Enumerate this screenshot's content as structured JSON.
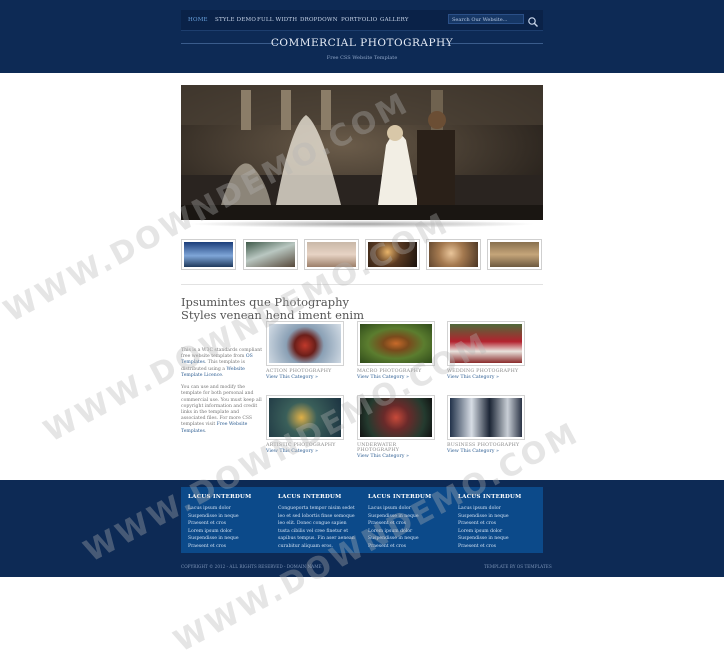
{
  "nav": {
    "items": [
      "HOME",
      "STYLE DEMO",
      "FULL WIDTH",
      "DROPDOWN",
      "PORTFOLIO",
      "GALLERY"
    ],
    "search_placeholder": "Search Our Website..."
  },
  "brand": {
    "title": "COMMERCIAL PHOTOGRAPHY",
    "subtitle": "Free CSS Website Template"
  },
  "main": {
    "title": "Ipsumintes que Photography Styles venean hend iment enim",
    "intro": [
      "This is a W3C standards compliant free website template from ",
      "OS Templates",
      ". This template is distributed using a ",
      "Website Template Licence",
      ".",
      "You can use and modify the template for both personal and commercial use. You must keep all copyright information and credit links in the template and associated files. For more CSS templates visit ",
      "Free Website Templates",
      "."
    ],
    "categories": [
      {
        "caption": "ACTION PHOTOGRAPHY",
        "link": "View This Category »"
      },
      {
        "caption": "MACRO PHOTOGRAPHY",
        "link": "View This Category »"
      },
      {
        "caption": "WEDDING PHOTOGRAPHY",
        "link": "View This Category »"
      },
      {
        "caption": "ARTISTIC PHOTOGRAPHY",
        "link": "View This Category »"
      },
      {
        "caption": "UNDERWATER PHOTOGRAPHY",
        "link": "View This Category »"
      },
      {
        "caption": "BUSINESS PHOTOGRAPHY",
        "link": "View This Category »"
      }
    ]
  },
  "footer": {
    "columns": [
      {
        "heading": "LACUS INTERDUM",
        "items": [
          "Lacus ipsum dolor",
          "Suspendisse in neque",
          "Praesent et cros",
          "Lorem ipsum dolor",
          "Suspendisse in neque",
          "Praesent et cros"
        ]
      },
      {
        "heading": "LACUS INTERDUM",
        "items": [
          "Congueporta tempor nisim sedet",
          "leo et sed lobortis finse semoque",
          "leo elit. Donec congue sapien",
          "tusta cibilis vel cree finetur et",
          "sapibus tempus. Fin aser aenean",
          "curabitur aliquam eros."
        ]
      },
      {
        "heading": "LACUS INTERDUM",
        "items": [
          "Lacus ipsum dolor",
          "Suspendisse in neque",
          "Praesent et cros",
          "Lorem ipsum dolor",
          "Suspendisse in neque",
          "Praesent et cros"
        ]
      },
      {
        "heading": "LACUS INTERDUM",
        "items": [
          "Lacus ipsum dolor",
          "Suspendisse in neque",
          "Praesent et cros",
          "Lorem ipsum dolor",
          "Suspendisse in neque",
          "Praesent et cros"
        ]
      }
    ],
    "copyright": "COPYRIGHT © 2012 - ALL RIGHTS RESERVED - DOMAIN NAME",
    "credit": "TEMPLATE BY OS TEMPLATES"
  },
  "watermark": "WWW.DOWNDEMO.COM",
  "colors": {
    "header_bg": "#0d2a55",
    "footer_panel": "#0c4a8a",
    "link": "#2f5f93",
    "nav_active": "#6aa3e0"
  }
}
